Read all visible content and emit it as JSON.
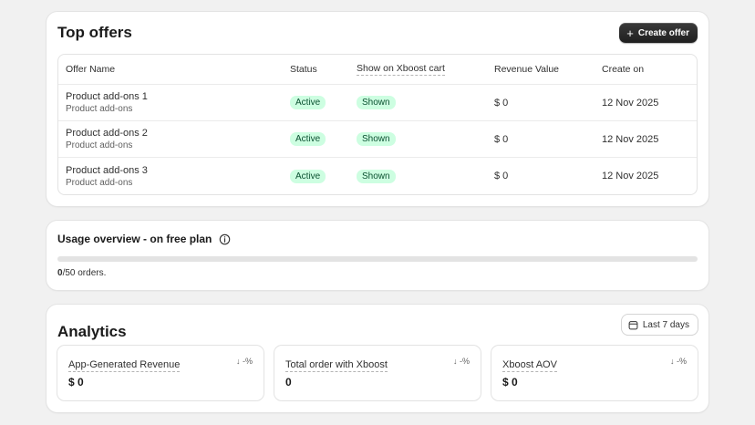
{
  "offers": {
    "title": "Top offers",
    "create_button": "Create offer",
    "columns": {
      "name": "Offer Name",
      "status": "Status",
      "show": "Show on Xboost cart",
      "revenue": "Revenue Value",
      "created": "Create on"
    },
    "rows": [
      {
        "name": "Product add-ons 1",
        "type": "Product add-ons",
        "status": "Active",
        "shown": "Shown",
        "revenue": "$ 0",
        "created": "12 Nov 2025"
      },
      {
        "name": "Product add-ons 2",
        "type": "Product add-ons",
        "status": "Active",
        "shown": "Shown",
        "revenue": "$ 0",
        "created": "12 Nov 2025"
      },
      {
        "name": "Product add-ons 3",
        "type": "Product add-ons",
        "status": "Active",
        "shown": "Shown",
        "revenue": "$ 0",
        "created": "12 Nov 2025"
      }
    ]
  },
  "usage": {
    "title": "Usage overview - on free plan",
    "used": "0",
    "limit_text": "/50 orders.",
    "progress": 0
  },
  "analytics": {
    "title": "Analytics",
    "range_button": "Last 7 days",
    "metrics": [
      {
        "label": "App-Generated Revenue",
        "value": "$ 0",
        "delta": "↓ -%"
      },
      {
        "label": "Total order with Xboost",
        "value": "0",
        "delta": "↓ -%"
      },
      {
        "label": "Xboost AOV",
        "value": "$ 0",
        "delta": "↓ -%"
      }
    ]
  },
  "colors": {
    "page_bg": "#f1f1f1",
    "badge_bg": "#cdfee1",
    "badge_text": "#0c5132",
    "primary_button": "#303030"
  },
  "icons": {
    "create": "plus-icon",
    "usage_info": "info-icon",
    "date_range": "calendar-icon"
  }
}
